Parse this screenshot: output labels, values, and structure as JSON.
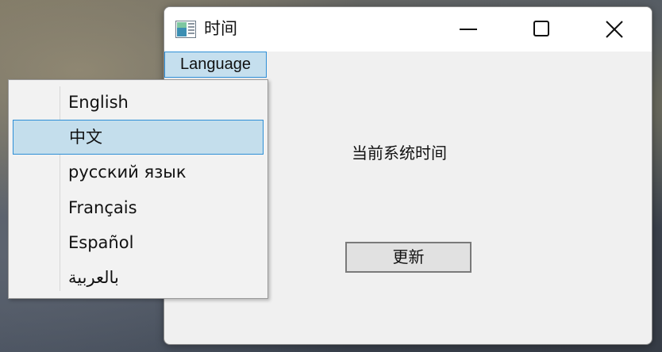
{
  "window": {
    "title": "时间",
    "icon": "app-window-icon",
    "controls": [
      "minimize-icon",
      "maximize-icon",
      "close-icon"
    ]
  },
  "menubar": {
    "items": [
      {
        "label": "Language"
      }
    ]
  },
  "dropdown": {
    "items": [
      {
        "label": "English"
      },
      {
        "label": "中文",
        "selected": true
      },
      {
        "label": "русский язык"
      },
      {
        "label": "Français"
      },
      {
        "label": "Español"
      },
      {
        "label": "بالعربية"
      }
    ]
  },
  "main": {
    "label": "当前系统时间",
    "button_label": "更新"
  },
  "colors": {
    "selection_fill": "#c4deec",
    "selection_border": "#2e8fd6",
    "window_bg": "#f0f0f0"
  }
}
